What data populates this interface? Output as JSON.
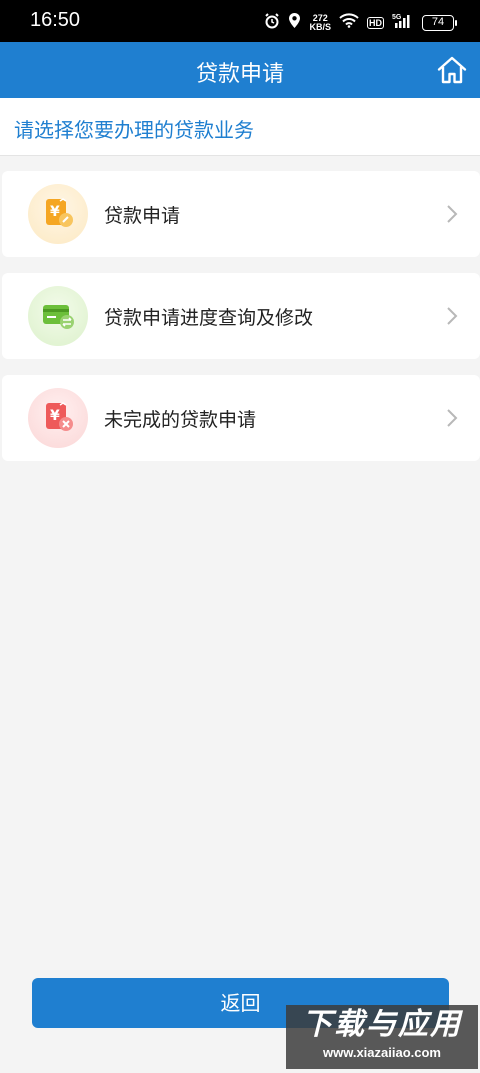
{
  "status_bar": {
    "time": "16:50",
    "net_speed_value": "272",
    "net_speed_unit": "KB/S",
    "hd": "HD",
    "signal_label": "5G",
    "battery": "74"
  },
  "nav": {
    "title": "贷款申请",
    "home_icon": "home-icon"
  },
  "section": {
    "title": "请选择您要办理的贷款业务"
  },
  "menu": {
    "items": [
      {
        "label": "贷款申请",
        "icon": "loan-apply-icon",
        "accent": "#f5a623",
        "bg": "#fdf2dc"
      },
      {
        "label": "贷款申请进度查询及修改",
        "icon": "loan-progress-icon",
        "accent": "#6cbf3a",
        "bg": "#e8f5de"
      },
      {
        "label": "未完成的贷款申请",
        "icon": "loan-unfinished-icon",
        "accent": "#ee5a5a",
        "bg": "#fde4e4"
      }
    ]
  },
  "footer": {
    "back_label": "返回"
  },
  "watermark": {
    "main": "下载与应用",
    "sub": "www.xiazaiiao.com"
  },
  "colors": {
    "primary": "#1f7fd0",
    "background": "#f4f4f4"
  }
}
